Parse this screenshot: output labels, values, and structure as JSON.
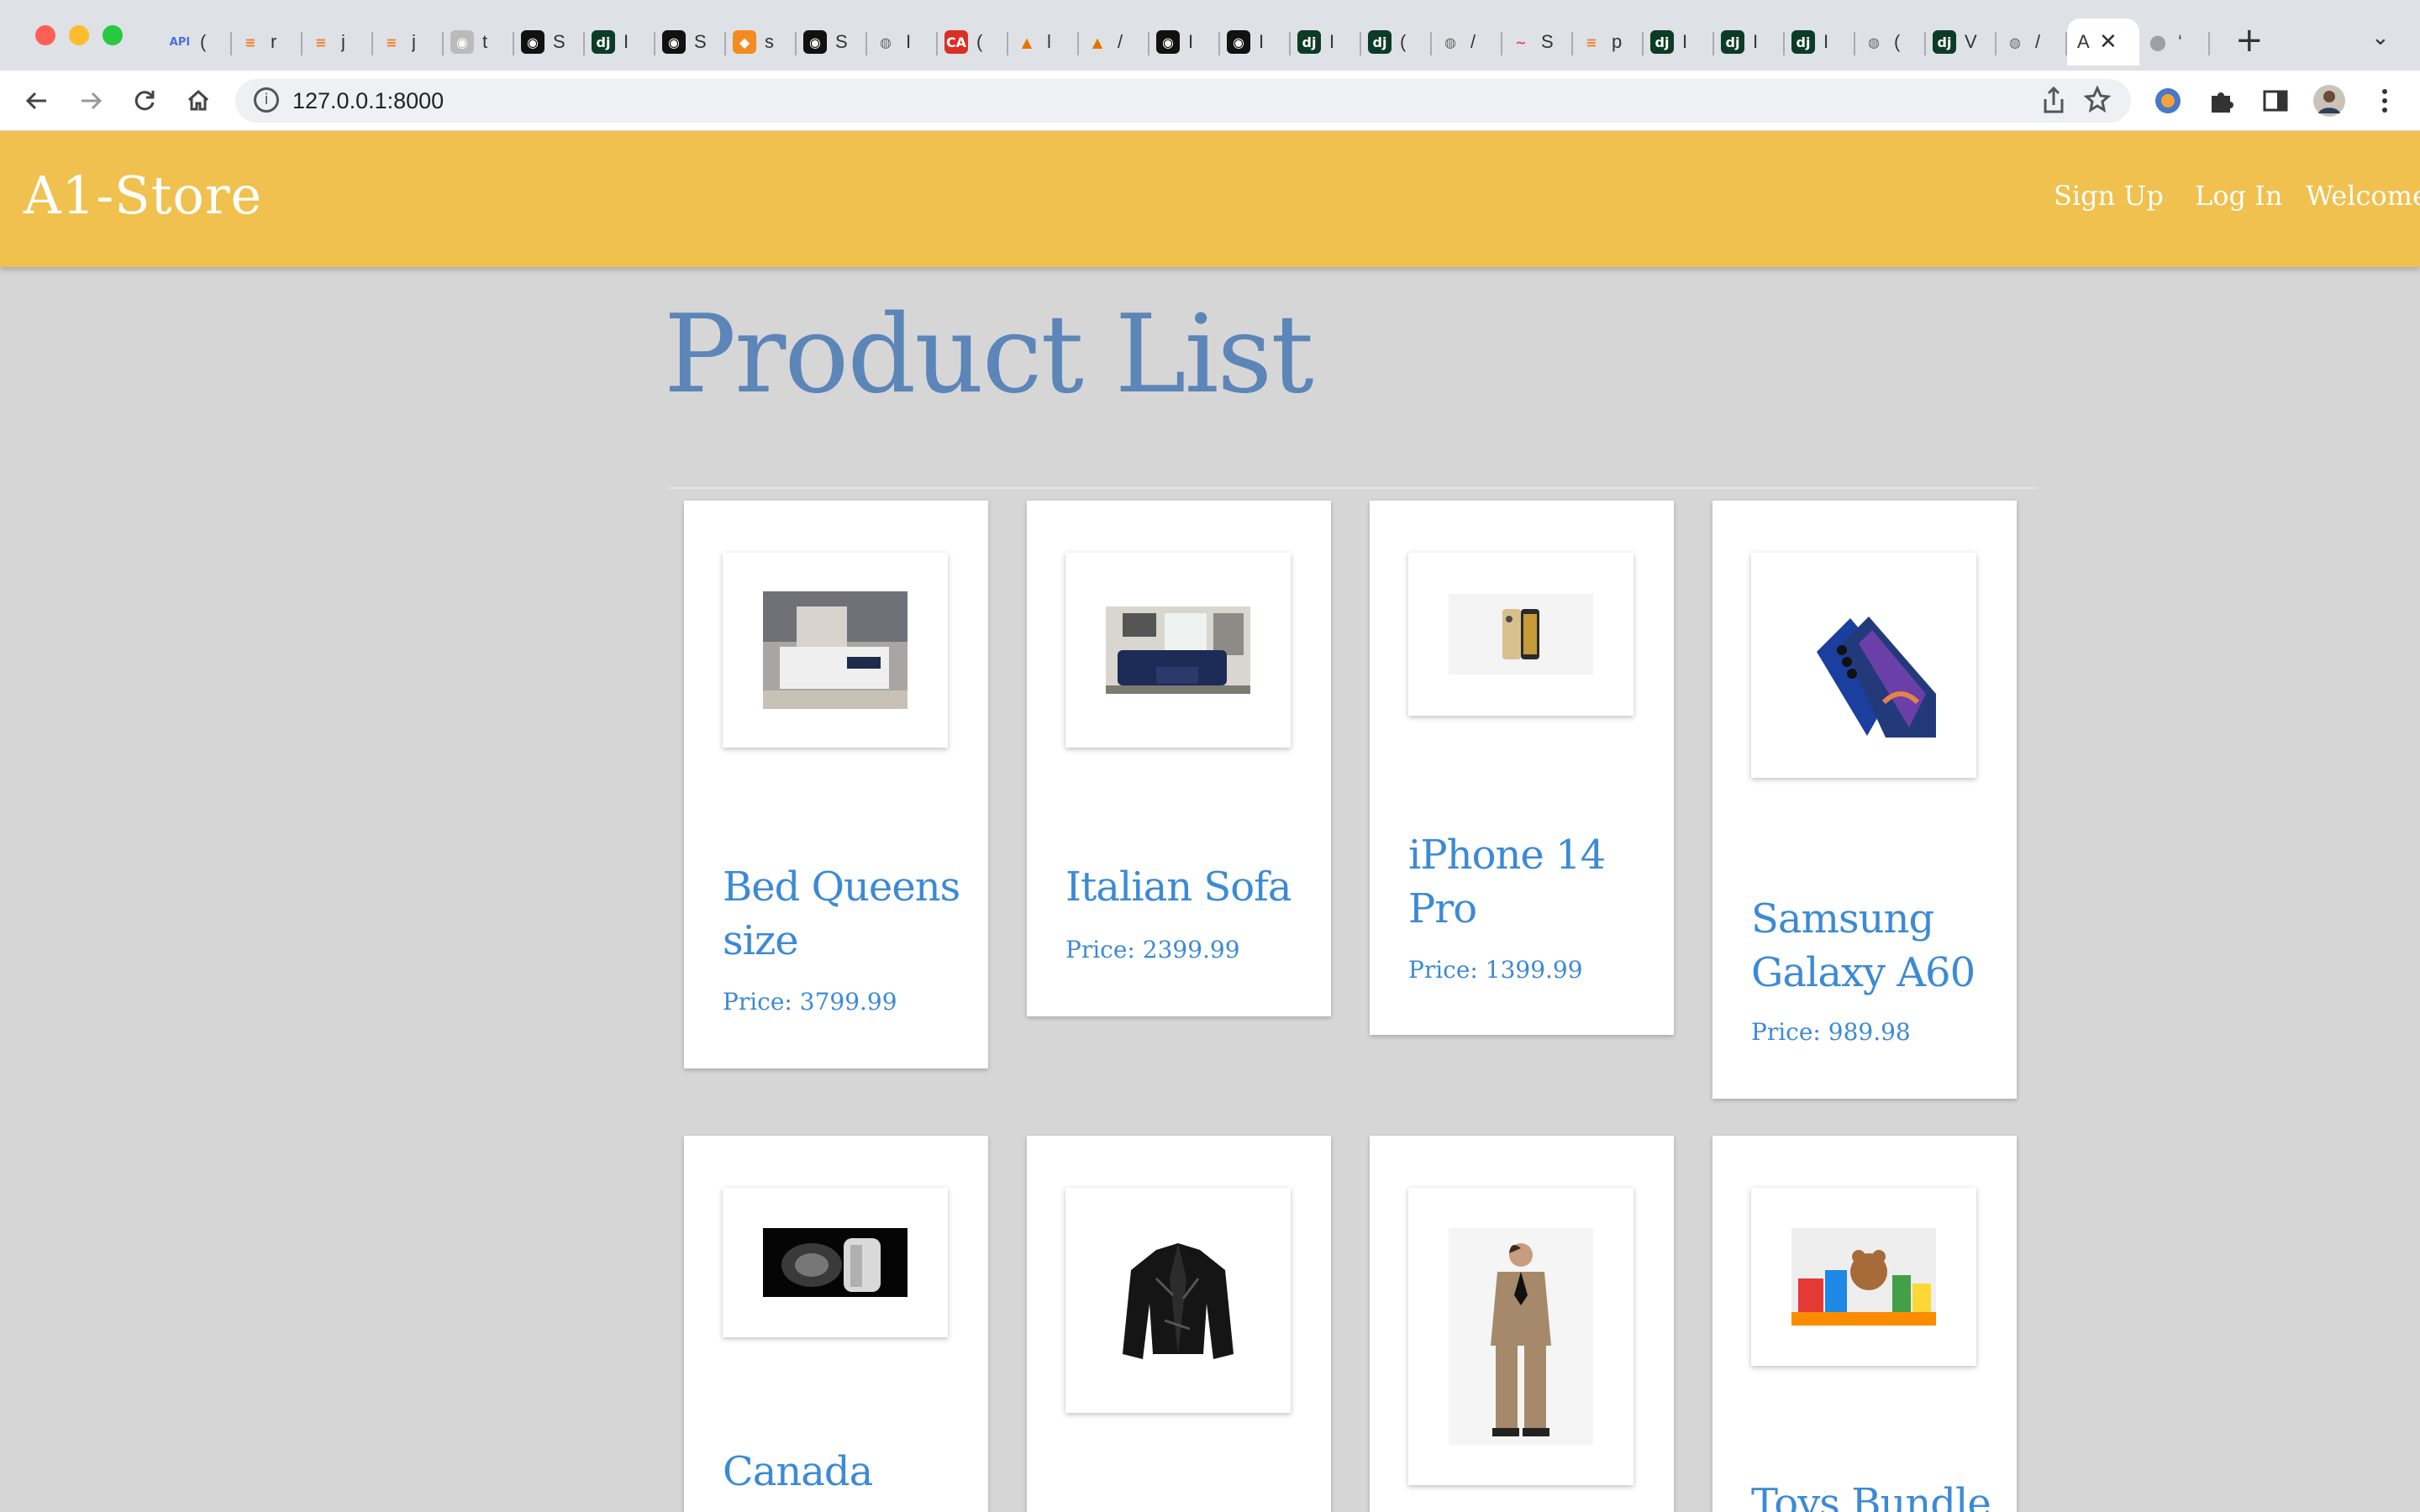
{
  "browser": {
    "tabs": [
      {
        "icon": "api-icon",
        "glyph": "API",
        "color": "#4a6fd8",
        "text": "("
      },
      {
        "icon": "stackoverflow-icon",
        "glyph": "≡",
        "color": "#f48024",
        "text": "r"
      },
      {
        "icon": "stackoverflow-icon",
        "glyph": "≡",
        "color": "#f48024",
        "text": "j"
      },
      {
        "icon": "stackoverflow-icon",
        "glyph": "≡",
        "color": "#f48024",
        "text": "j"
      },
      {
        "icon": "github-icon",
        "glyph": "◉",
        "color": "#bbbbbb",
        "text": "t"
      },
      {
        "icon": "github-icon",
        "glyph": "◉",
        "color": "#111111",
        "text": "S"
      },
      {
        "icon": "django-icon",
        "glyph": "dj",
        "color": "#0c3c26",
        "text": "I"
      },
      {
        "icon": "github-icon",
        "glyph": "◉",
        "color": "#111111",
        "text": "S"
      },
      {
        "icon": "package-icon",
        "glyph": "◆",
        "color": "#f28b20",
        "text": "s"
      },
      {
        "icon": "github-icon",
        "glyph": "◉",
        "color": "#111111",
        "text": "S"
      },
      {
        "icon": "globe-icon",
        "glyph": "◍",
        "color": "#666666",
        "text": "I"
      },
      {
        "icon": "ca-icon",
        "glyph": "CA",
        "color": "#d93025",
        "text": "("
      },
      {
        "icon": "tree-icon",
        "glyph": "▲",
        "color": "#e37400",
        "text": "l"
      },
      {
        "icon": "tree-icon",
        "glyph": "▲",
        "color": "#e37400",
        "text": "/"
      },
      {
        "icon": "github-icon",
        "glyph": "◉",
        "color": "#111111",
        "text": "I"
      },
      {
        "icon": "github-icon",
        "glyph": "◉",
        "color": "#111111",
        "text": "I"
      },
      {
        "icon": "django-icon",
        "glyph": "dj",
        "color": "#0c3c26",
        "text": "I"
      },
      {
        "icon": "django-icon",
        "glyph": "dj",
        "color": "#0c3c26",
        "text": "("
      },
      {
        "icon": "globe-icon",
        "glyph": "◍",
        "color": "#666666",
        "text": "/"
      },
      {
        "icon": "wave-icon",
        "glyph": "~",
        "color": "#e8485a",
        "text": "S"
      },
      {
        "icon": "stackoverflow-icon",
        "glyph": "≡",
        "color": "#f48024",
        "text": "p"
      },
      {
        "icon": "django-icon",
        "glyph": "dj",
        "color": "#0c3c26",
        "text": "I"
      },
      {
        "icon": "django-icon",
        "glyph": "dj",
        "color": "#0c3c26",
        "text": "I"
      },
      {
        "icon": "django-icon",
        "glyph": "dj",
        "color": "#0c3c26",
        "text": "I"
      },
      {
        "icon": "globe-icon",
        "glyph": "◍",
        "color": "#666666",
        "text": "("
      },
      {
        "icon": "django-icon",
        "glyph": "dj",
        "color": "#0c3c26",
        "text": "V"
      },
      {
        "icon": "globe-icon",
        "glyph": "◍",
        "color": "#666666",
        "text": "/"
      }
    ],
    "active_tab": {
      "text": "A",
      "close": "✕"
    },
    "last_tab": {
      "glyph": "●",
      "text": "‘"
    },
    "new_tab": "+",
    "tab_menu": "⌄",
    "url": "127.0.0.1:8000",
    "info_glyph": "i"
  },
  "site": {
    "brand": "A1-Store",
    "nav": {
      "signup": "Sign Up",
      "login": "Log In",
      "welcome": "Welcome"
    },
    "colors": {
      "header": "#f0c14f",
      "title": "#5c85b8",
      "product_text": "#3c8ad6",
      "background": "#d6d6d6"
    },
    "page_title": "Product List",
    "price_prefix": "Price: ",
    "products": [
      {
        "name": "Bed Queens size",
        "price": "3799.99",
        "image": "bed-image"
      },
      {
        "name": "Italian Sofa",
        "price": "2399.99",
        "image": "sofa-image"
      },
      {
        "name": "iPhone 14 Pro",
        "price": "1399.99",
        "image": "iphone-image"
      },
      {
        "name": "Samsung Galaxy A60",
        "price": "989.98",
        "image": "samsung-phone-image"
      },
      {
        "name": "Canada",
        "price": "",
        "image": "jacket-image"
      },
      {
        "name": "",
        "price": "",
        "image": "leather-jacket-image"
      },
      {
        "name": "",
        "price": "",
        "image": "suit-image"
      },
      {
        "name": "Toys Bundle",
        "price": "",
        "image": "toys-image"
      }
    ]
  }
}
